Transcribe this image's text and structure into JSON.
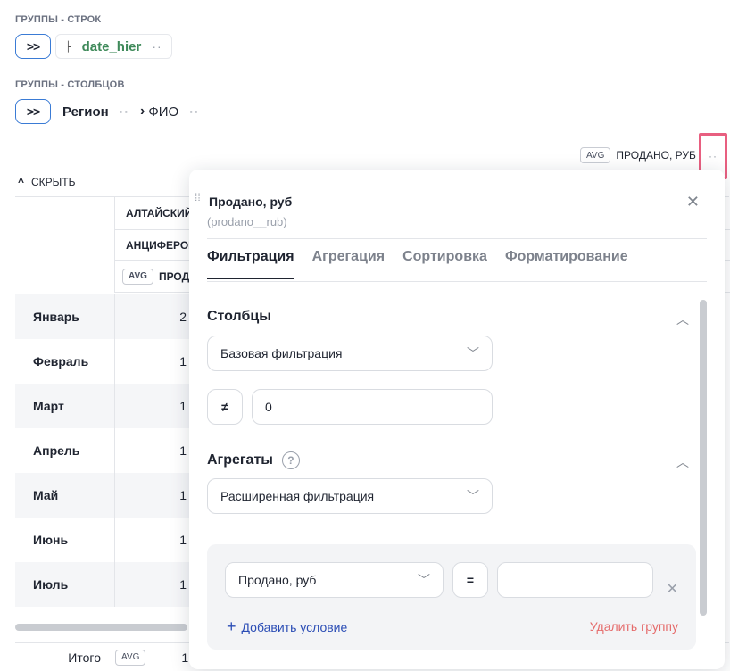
{
  "row_groups": {
    "label": "ГРУППЫ - СТРОК",
    "expand_label": ">>",
    "chip": {
      "text": "date_hier",
      "icon": "hierarchy-icon"
    }
  },
  "column_groups": {
    "label": "ГРУППЫ - СТОЛБЦОВ",
    "expand_label": ">>",
    "items": [
      "Регион",
      "ФИО"
    ]
  },
  "measure_header": {
    "agg": "AVG",
    "label": "ПРОДАНО, РУБ"
  },
  "table": {
    "hide_label": "СКРЫТЬ",
    "header_region": "АЛТАЙСКИЙ",
    "header_person": "АНЦИФЕРОВ",
    "header_measure_agg": "AVG",
    "header_measure": "ПРОД",
    "rows": [
      {
        "label": "Январь",
        "value": "2"
      },
      {
        "label": "Февраль",
        "value": "1"
      },
      {
        "label": "Март",
        "value": "1"
      },
      {
        "label": "Апрель",
        "value": "1"
      },
      {
        "label": "Май",
        "value": "1"
      },
      {
        "label": "Июнь",
        "value": "1"
      },
      {
        "label": "Июль",
        "value": "1"
      }
    ],
    "total": {
      "label": "Итого",
      "agg": "AVG",
      "value": "1"
    }
  },
  "panel": {
    "title": "Продано, руб",
    "subtitle": "(prodano__rub)",
    "tabs": [
      "Фильтрация",
      "Агрегация",
      "Сортировка",
      "Форматирование"
    ],
    "active_tab": "Фильтрация",
    "columns_section": {
      "title": "Столбцы",
      "filter_mode": "Базовая фильтрация",
      "operator": "≠",
      "value": "0"
    },
    "aggregates_section": {
      "title": "Агрегаты",
      "help": "?",
      "filter_mode": "Расширенная фильтрация",
      "condition": {
        "field": "Продано, руб",
        "operator": "=",
        "value": ""
      },
      "add_condition": "Добавить условие",
      "delete_group": "Удалить группу"
    }
  },
  "colors": {
    "accent_blue": "#3a7bd5",
    "link_blue": "#2b4db5",
    "danger": "#e56c6c",
    "highlight": "#e85f80",
    "chip_green": "#3f8a5a"
  }
}
